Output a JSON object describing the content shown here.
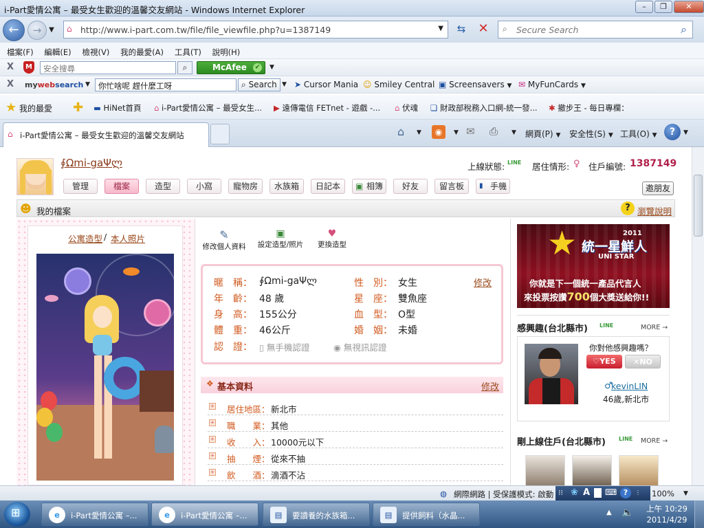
{
  "window": {
    "title": "i-Part愛情公寓 – 最受女生歡迎的溫馨交友網站 - Windows Internet Explorer",
    "minimize": "–",
    "restore": "❐",
    "close": "✕"
  },
  "address": {
    "url": "http://www.i-part.com.tw/file/file_viewfile.php?u=1387149",
    "search_placeholder": "Secure Search"
  },
  "menu": [
    "檔案(F)",
    "編輯(E)",
    "檢視(V)",
    "我的最愛(A)",
    "工具(T)",
    "說明(H)"
  ],
  "toolbar1": {
    "close": "X",
    "search_placeholder": "安全搜尋",
    "mcafee": "McAfee"
  },
  "toolbar2": {
    "close": "X",
    "brand_my": "my",
    "brand_web": "web",
    "brand_search": "search",
    "query": "你忙啥呢 趕什麼工呀",
    "search_button": "Search",
    "links": [
      "Cursor Mania",
      "Smiley Central",
      "Screensavers",
      "MyFunCards"
    ]
  },
  "favorites": {
    "label": "我的最愛",
    "items": [
      "HiNet首頁",
      "i-Part愛情公寓 – 最受女生...",
      "遠傳電信 FETnet - 遊戲 -...",
      "伏魂",
      "財政部稅務入口網-統一發...",
      "撤步王 - 每日專欄："
    ]
  },
  "tab": {
    "title": "i-Part愛情公寓 – 最受女生歡迎的溫馨交友網站"
  },
  "commands": {
    "page": "網頁(P)",
    "safety": "安全性(S)",
    "tools": "工具(O)"
  },
  "profile": {
    "nickname": "∮Ωmi-gaΨლ",
    "online_label": "上線狀態:",
    "online_badge": "LINE",
    "residence_label": "居住情形:",
    "resident_id_label": "住戶編號:",
    "resident_id": "1387149",
    "tabs": [
      "管理",
      "檔案",
      "造型",
      "小窩",
      "寵物房",
      "水族箱",
      "日記本",
      "相簿",
      "好友",
      "留言板",
      "手機"
    ],
    "invite": "邀朋友",
    "section_title": "我的檔案",
    "help": "瀏覽說明",
    "photo_tab1": "公寓造型",
    "photo_sep": "/",
    "photo_tab2": "本人照片",
    "actions": [
      "修改個人資料",
      "設定造型/照片",
      "更換造型"
    ],
    "info": {
      "nick_label": "暱　稱：",
      "nick": "∮Ωmi-gaΨლ",
      "gender_label": "性　別：",
      "gender": "女生",
      "age_label": "年　齡：",
      "age": "48 歲",
      "sign_label": "星　座：",
      "sign": "雙魚座",
      "height_label": "身　高：",
      "height": "155公分",
      "blood_label": "血　型：",
      "blood": "O型",
      "weight_label": "體　重：",
      "weight": "46公斤",
      "marriage_label": "婚　姻：",
      "marriage": "未婚",
      "verify_label": "認　證：",
      "verify_phone": "無手機認證",
      "verify_video": "無視訊認證",
      "edit": "修改"
    },
    "basic": {
      "title": "基本資料",
      "edit": "修改",
      "rows": [
        {
          "label": "居住地區：",
          "value": "新北市"
        },
        {
          "label": "職　　業：",
          "value": "其他"
        },
        {
          "label": "收　　入：",
          "value": "10000元以下"
        },
        {
          "label": "抽　　煙：",
          "value": "從來不抽"
        },
        {
          "label": "飲　　酒：",
          "value": "滴酒不沾"
        }
      ]
    }
  },
  "ad": {
    "brand": "統一星鮮人",
    "year": "2011",
    "sub": "UNI STAR",
    "line1": "你就是下一個統一產品代言人",
    "line2_a": "來投票按讚",
    "line2_num": "700",
    "line2_b": "個大獎送給你!!"
  },
  "interest": {
    "title": "感興趣(台北縣市)",
    "badge": "LINE",
    "more": "MORE →",
    "question": "你對他感興趣嗎？",
    "yes": "♡YES",
    "no": "✕NO",
    "user": "kevinLIN",
    "user_info": "46歲,新北市"
  },
  "recent": {
    "title": "剛上線住戶(台北縣市)",
    "badge": "LINE",
    "more": "MORE →"
  },
  "status": {
    "zone": "網際網路 | 受保護模式: 啟動",
    "zoom": "100%"
  },
  "taskbar": {
    "items": [
      "i-Part愛情公寓 –...",
      "i-Part愛情公寓 –...",
      "要讀養的水族箱...",
      "提供飼料（水晶..."
    ],
    "time": "上午 10:29",
    "date": "2011/4/29"
  },
  "colors": {
    "accent_orange": "#d15b20",
    "id_red": "#b0204a",
    "pink": "#f7b9cb"
  }
}
